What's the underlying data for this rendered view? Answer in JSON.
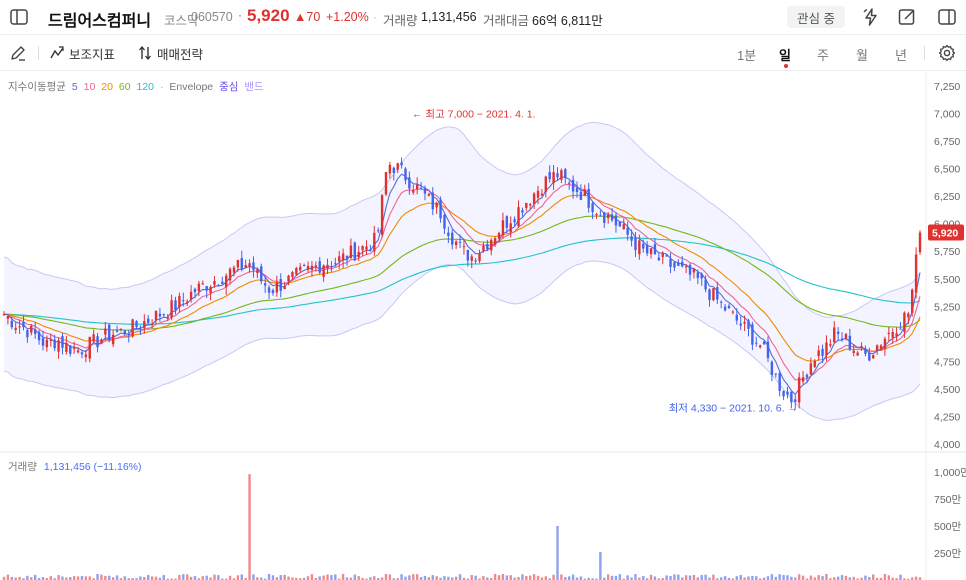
{
  "header": {
    "stock_name": "드림어스컴퍼니",
    "market": "코스닥",
    "code": "060570",
    "price": "5,920",
    "change": "▲70",
    "change_pct": "+1.20%",
    "volume_label": "거래량",
    "volume_value": "1,131,456",
    "amount_label": "거래대금",
    "amount_value": "66억 6,811만",
    "watch_label": "관심 중",
    "icons": [
      "sidebar-icon",
      "flash-icon",
      "edit-icon",
      "panel-icon"
    ]
  },
  "toolbar": {
    "indicator_label": "보조지표",
    "strategy_label": "매매전략",
    "periods": [
      "1분",
      "일",
      "주",
      "월",
      "년"
    ],
    "active_period": "일"
  },
  "legend": {
    "ma_label": "지수이동평균",
    "ma_periods": [
      {
        "label": "5",
        "color": "#5c6bd6"
      },
      {
        "label": "10",
        "color": "#f06595"
      },
      {
        "label": "20",
        "color": "#f08c00"
      },
      {
        "label": "60",
        "color": "#74b816"
      },
      {
        "label": "120",
        "color": "#22c3c9"
      }
    ],
    "separator": "·",
    "envelope_label": "Envelope",
    "envelope_center": "중심",
    "envelope_band": "밴드",
    "volume_title": "거래량",
    "volume_value": "1,131,456 (−11.16%)"
  },
  "chart_data": {
    "type": "candlestick",
    "price_axis_ticks": [
      "7,250",
      "7,000",
      "6,750",
      "6,500",
      "6,250",
      "6,000",
      "5,750",
      "5,500",
      "5,250",
      "5,000",
      "4,750",
      "4,500",
      "4,250",
      "4,000"
    ],
    "volume_axis_ticks": [
      "1,000만",
      "750만",
      "500만",
      "250만"
    ],
    "current_price_tag": "5,920",
    "high_annotation": "← 최고 7,000 − 2021. 4. 1.",
    "low_annotation": "최저 4,330 − 2021. 10. 6. →",
    "price_range": [
      4000,
      7250
    ],
    "volume_range": [
      0,
      10000000
    ],
    "close_path": [
      5180,
      5100,
      5050,
      4980,
      4900,
      4950,
      4880,
      4850,
      4900,
      4950,
      5000,
      5020,
      5050,
      5100,
      5150,
      5200,
      5250,
      5320,
      5400,
      5450,
      5500,
      5550,
      5600,
      5650,
      5500,
      5400,
      5450,
      5500,
      5550,
      5600,
      5650,
      5650,
      5700,
      5750,
      5800,
      5850,
      6550,
      6500,
      6400,
      6300,
      6200,
      6100,
      5900,
      5750,
      5700,
      5800,
      5900,
      6000,
      6100,
      6200,
      6300,
      6400,
      6450,
      6350,
      6300,
      6200,
      6100,
      6050,
      5950,
      5850,
      5750,
      5700,
      5650,
      5600,
      5550,
      5500,
      5400,
      5300,
      5200,
      5100,
      5000,
      4900,
      4700,
      4500,
      4400,
      4600,
      4800,
      4850,
      5000,
      4950,
      4850,
      4800,
      4900,
      5000,
      5100,
      5200,
      5920
    ],
    "volume_spikes": [
      {
        "index": 23,
        "value": 9800000
      },
      {
        "index": 52,
        "value": 5000000
      },
      {
        "index": 56,
        "value": 2600000
      }
    ],
    "ylabel": "",
    "grid": true
  }
}
